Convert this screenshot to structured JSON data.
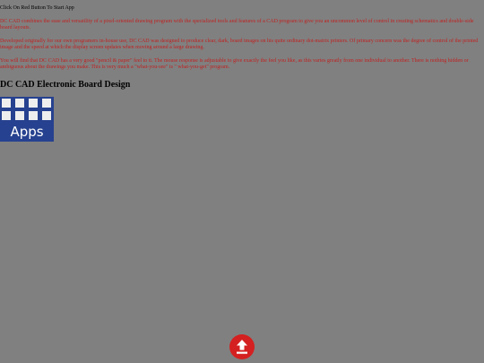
{
  "intro": {
    "text": "Click On Red Button To Start App"
  },
  "description": {
    "p1": "DC CAD combines the ease and versatility of a pixel-oriented drawing program with the specialized tools and features of a CAD program to give you an uncommon level of control in creating schematics and double-side board layouts.",
    "p2": "Developed originally for our own programers in-house use, DC CAD was designed to produce clear, dark, board images on his quite ordinary dot-matrix printers. Of primary concern was the degree of control of the printed image and the speed at which the display screen updates when moving around a large drawing.",
    "p3": "You will find that DC CAD has a very good \"pencil & paper\" feel to it. The mouse response is adjustable to give exactly the feel you like, as this varies greatly from one individual to another. There is nothing hidden or ambiguous about the drawings you make. This is very much a \"what-you-see\" is \" what-you-get\" program."
  },
  "heading": {
    "title": "DC CAD Electronic Board Design"
  },
  "apps_tile": {
    "label": "Apps",
    "icon": "apps-grid-icon",
    "background": "#26418f"
  },
  "start_button": {
    "icon": "upload-arrow-icon",
    "color": "#d42020"
  },
  "colors": {
    "page_background": "#808080",
    "body_text": "#c02020"
  }
}
